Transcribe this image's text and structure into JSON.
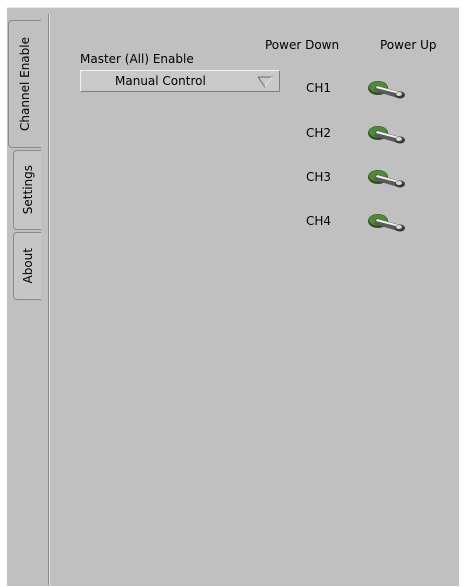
{
  "tabs": [
    {
      "label": "Channel Enable",
      "active": true
    },
    {
      "label": "Settings",
      "active": false
    },
    {
      "label": "About",
      "active": false
    }
  ],
  "master": {
    "label": "Master (All) Enable",
    "selected": "Manual Control"
  },
  "headers": {
    "power_down": "Power Down",
    "power_up": "Power Up"
  },
  "channels": [
    {
      "label": "CH1",
      "state": "Power Down"
    },
    {
      "label": "CH2",
      "state": "Power Down"
    },
    {
      "label": "CH3",
      "state": "Power Down"
    },
    {
      "label": "CH4",
      "state": "Power Down"
    }
  ],
  "colors": {
    "panel": "#c0c0c0",
    "toggle_base": "#3d6b2b"
  }
}
